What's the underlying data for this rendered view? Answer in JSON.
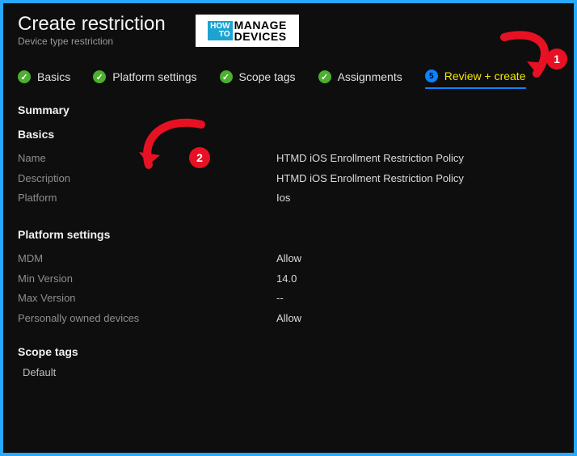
{
  "header": {
    "title": "Create restriction",
    "subtitle": "Device type restriction"
  },
  "logo": {
    "how": "HOW",
    "to": "TO",
    "line1": "MANAGE",
    "line2": "DEVICES"
  },
  "tabs": {
    "basics": "Basics",
    "platform_settings": "Platform settings",
    "scope_tags": "Scope tags",
    "assignments": "Assignments",
    "review_create": "Review + create",
    "review_step_num": "5"
  },
  "summary_label": "Summary",
  "sections": {
    "basics": {
      "heading": "Basics",
      "name_label": "Name",
      "name_value": "HTMD iOS Enrollment Restriction Policy",
      "desc_label": "Description",
      "desc_value": "HTMD iOS Enrollment Restriction Policy",
      "platform_label": "Platform",
      "platform_value": "Ios"
    },
    "platform_settings": {
      "heading": "Platform settings",
      "mdm_label": "MDM",
      "mdm_value": "Allow",
      "min_label": "Min Version",
      "min_value": "14.0",
      "max_label": "Max Version",
      "max_value": "--",
      "personal_label": "Personally owned devices",
      "personal_value": "Allow"
    },
    "scope_tags": {
      "heading": "Scope tags",
      "default": "Default"
    }
  },
  "annotations": {
    "badge1": "1",
    "badge2": "2"
  }
}
